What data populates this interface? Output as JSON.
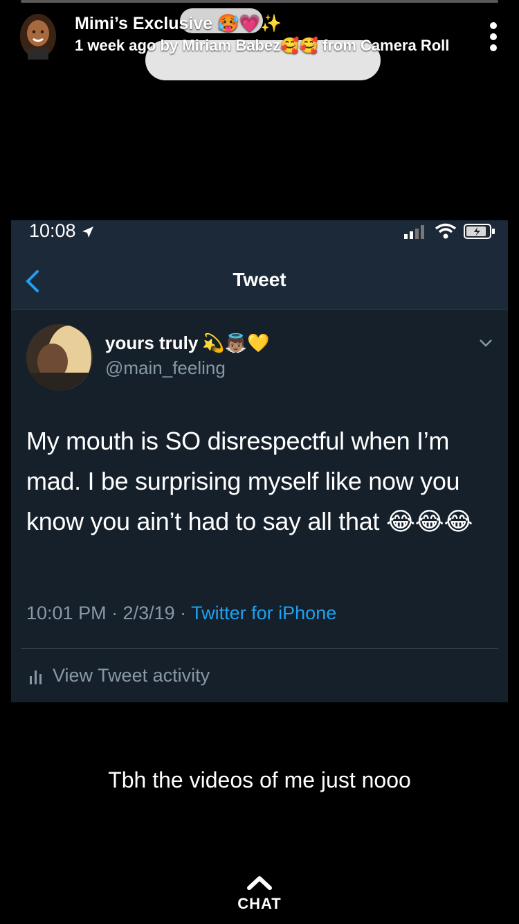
{
  "story": {
    "title": "Mimi’s Exclusive 🥵💗✨",
    "subtitle": "1 week ago by Miriam Babez🥰🥰 from Camera Roll"
  },
  "tweet": {
    "status_time": "10:08",
    "nav_title": "Tweet",
    "display_name": "yours truly",
    "name_emojis": "💫👼🏽💛",
    "handle": "@main_feeling",
    "text": "My mouth is SO disrespectful when I’m mad. I be surprising myself like now you know you ain’t had to say all that",
    "text_emojis": "😂😂😂",
    "timestamp": "10:01 PM · 2/3/19 · ",
    "source": "Twitter for iPhone",
    "activity_label": "View Tweet activity"
  },
  "caption": "Tbh the videos of me just nooo",
  "chat_label": "CHAT",
  "colors": {
    "tweet_bg": "#15202b",
    "link_blue": "#1da1f2",
    "muted": "#8899a6"
  },
  "icons": [
    "more-icon",
    "back-chevron-icon",
    "location-arrow-icon",
    "signal-icon",
    "wifi-icon",
    "battery-icon",
    "caret-down-icon",
    "bar-chart-icon",
    "chat-chevron-icon"
  ]
}
